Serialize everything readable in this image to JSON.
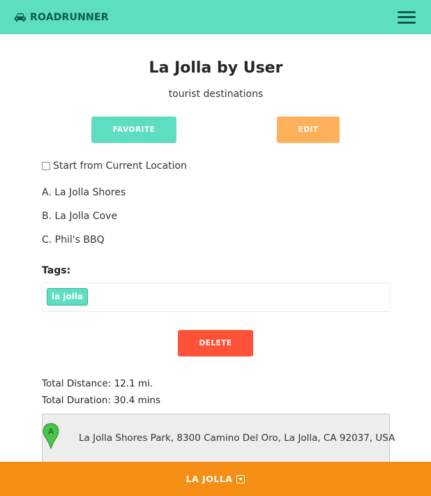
{
  "app": {
    "brand": "ROADRUNNER",
    "accent_color": "#5ddec0",
    "brand_icon": "car-icon",
    "menu_icon": "hamburger-menu-icon"
  },
  "trip": {
    "title": "La Jolla by User",
    "description": "tourist destinations",
    "favorite_label": "FAVORITE",
    "edit_label": "EDIT",
    "start_from_current_label": "Start from Current Location",
    "start_from_current_checked": false,
    "stops": [
      "A. La Jolla Shores",
      "B. La Jolla Cove",
      "C. Phil's BBQ"
    ],
    "tags_label": "Tags:",
    "tags": [
      "la jolla"
    ],
    "delete_label": "DELETE",
    "total_distance": "Total Distance: 12.1 mi.",
    "total_duration": "Total Duration: 30.4 mins"
  },
  "directions": {
    "marker_letter": "A",
    "marker_icon": "map-pin-icon",
    "address": "La Jolla Shores Park, 8300 Camino Del Oro, La Jolla, CA 92037, USA"
  },
  "footer": {
    "label": "LA JOLLA",
    "icon": "caret-down-square-icon"
  },
  "colors": {
    "favorite": "#5ddec0",
    "edit": "#ffb05a",
    "delete": "#ff5238",
    "footer": "#f48e14"
  }
}
